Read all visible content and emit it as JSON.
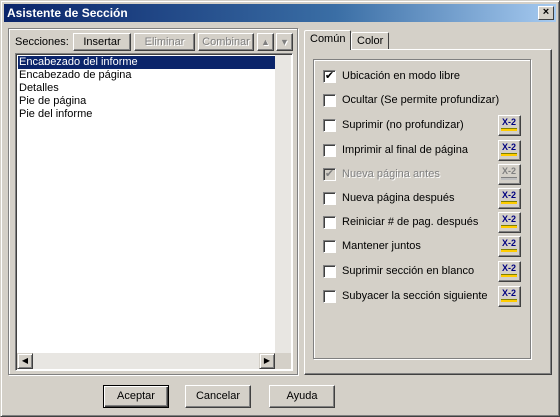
{
  "window": {
    "title": "Asistente de Sección",
    "close_glyph": "×"
  },
  "sections_panel": {
    "label": "Secciones:",
    "buttons": {
      "insert": "Insertar",
      "delete": "Eliminar",
      "combine": "Combinar",
      "move_up": "▲",
      "move_down": "▼"
    },
    "items": [
      {
        "label": "Encabezado del informe",
        "selected": true
      },
      {
        "label": "Encabezado de página",
        "selected": false
      },
      {
        "label": "Detalles",
        "selected": false
      },
      {
        "label": "Pie de página",
        "selected": false
      },
      {
        "label": "Pie del informe",
        "selected": false
      }
    ]
  },
  "tabs": [
    {
      "label": "Común",
      "active": true
    },
    {
      "label": "Color",
      "active": false
    }
  ],
  "options": [
    {
      "label": "Ubicación en modo libre",
      "checked": true,
      "enabled": true,
      "has_formula": false
    },
    {
      "label": "Ocultar (Se permite profundizar)",
      "checked": false,
      "enabled": true,
      "has_formula": false
    },
    {
      "label": "Suprimir (no profundizar)",
      "checked": false,
      "enabled": true,
      "has_formula": true
    },
    {
      "label": "Imprimir al final de página",
      "checked": false,
      "enabled": true,
      "has_formula": true
    },
    {
      "label": "Nueva página antes",
      "checked": true,
      "enabled": false,
      "has_formula": true
    },
    {
      "label": "Nueva página después",
      "checked": false,
      "enabled": true,
      "has_formula": true
    },
    {
      "label": "Reiniciar # de pag. después",
      "checked": false,
      "enabled": true,
      "has_formula": true
    },
    {
      "label": "Mantener juntos",
      "checked": false,
      "enabled": true,
      "has_formula": true
    },
    {
      "label": "Suprimir sección en blanco",
      "checked": false,
      "enabled": true,
      "has_formula": true
    },
    {
      "label": "Subyacer la sección siguiente",
      "checked": false,
      "enabled": true,
      "has_formula": true
    }
  ],
  "formula_icon": {
    "name": "formula-editor-icon",
    "text": "X-2"
  },
  "checkmark": "✔",
  "footer": {
    "ok": "Aceptar",
    "cancel": "Cancelar",
    "help": "Ayuda"
  },
  "scroll_glyphs": {
    "left": "◀",
    "right": "▶"
  },
  "colors": {
    "title_start": "#0a246a",
    "title_end": "#a6caf0",
    "selection": "#0a246a",
    "face": "#d4d0c8"
  }
}
